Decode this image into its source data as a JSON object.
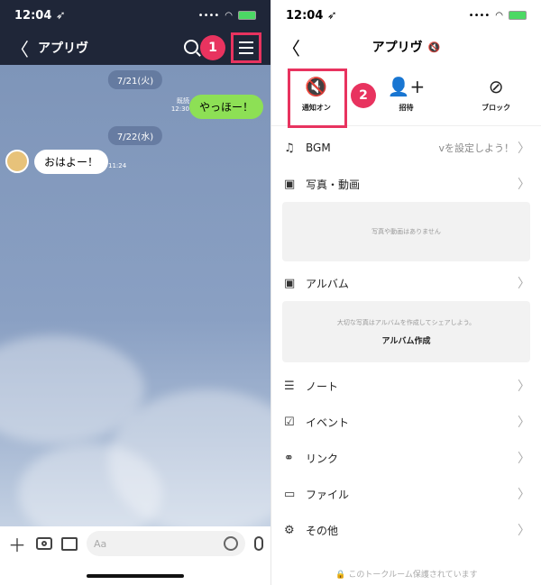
{
  "left": {
    "status": {
      "time": "12:04 ➶"
    },
    "header": {
      "back": "〈",
      "title": "アプリヴ",
      "badge": "1"
    },
    "dates": [
      "7/21(火)",
      "7/22(水)"
    ],
    "messages": [
      {
        "dir": "out",
        "text": "やっほー！",
        "read": "既読",
        "time": "12:30"
      },
      {
        "dir": "in",
        "text": "おはよー！",
        "time": "11:24"
      }
    ],
    "input": {
      "placeholder": "Aa",
      "plus": "＋"
    }
  },
  "right": {
    "status": {
      "time": "12:04 ➶"
    },
    "header": {
      "back": "〈",
      "title": "アプリヴ",
      "mute": "🔇"
    },
    "actions": [
      {
        "label": "通知オン",
        "icon": "🔇"
      },
      {
        "label": "招待",
        "icon": "👤+"
      },
      {
        "label": "ブロック",
        "icon": "⊘"
      }
    ],
    "badge": "2",
    "rows": {
      "bgm": {
        "icon": "♫",
        "label": "BGM",
        "value": "vを設定しよう！"
      },
      "photos": {
        "icon": "▣",
        "label": "写真・動画"
      },
      "photos_empty": "写真や動画はありません",
      "album": {
        "icon": "▣",
        "label": "アルバム"
      },
      "album_desc": "大切な写真はアルバムを作成してシェアしよう。",
      "album_create": "アルバム作成",
      "note": {
        "icon": "☰",
        "label": "ノート"
      },
      "event": {
        "icon": "☑",
        "label": "イベント"
      },
      "link": {
        "icon": "⚭",
        "label": "リンク"
      },
      "file": {
        "icon": "▭",
        "label": "ファイル"
      },
      "other": {
        "icon": "⚙",
        "label": "その他"
      }
    },
    "chevron": "〉",
    "footer": "🔒 このトークルーム保護されています"
  },
  "colors": {
    "accent": "#e8335f",
    "bubble_out": "#8de055",
    "header_bg": "#1f2638"
  }
}
